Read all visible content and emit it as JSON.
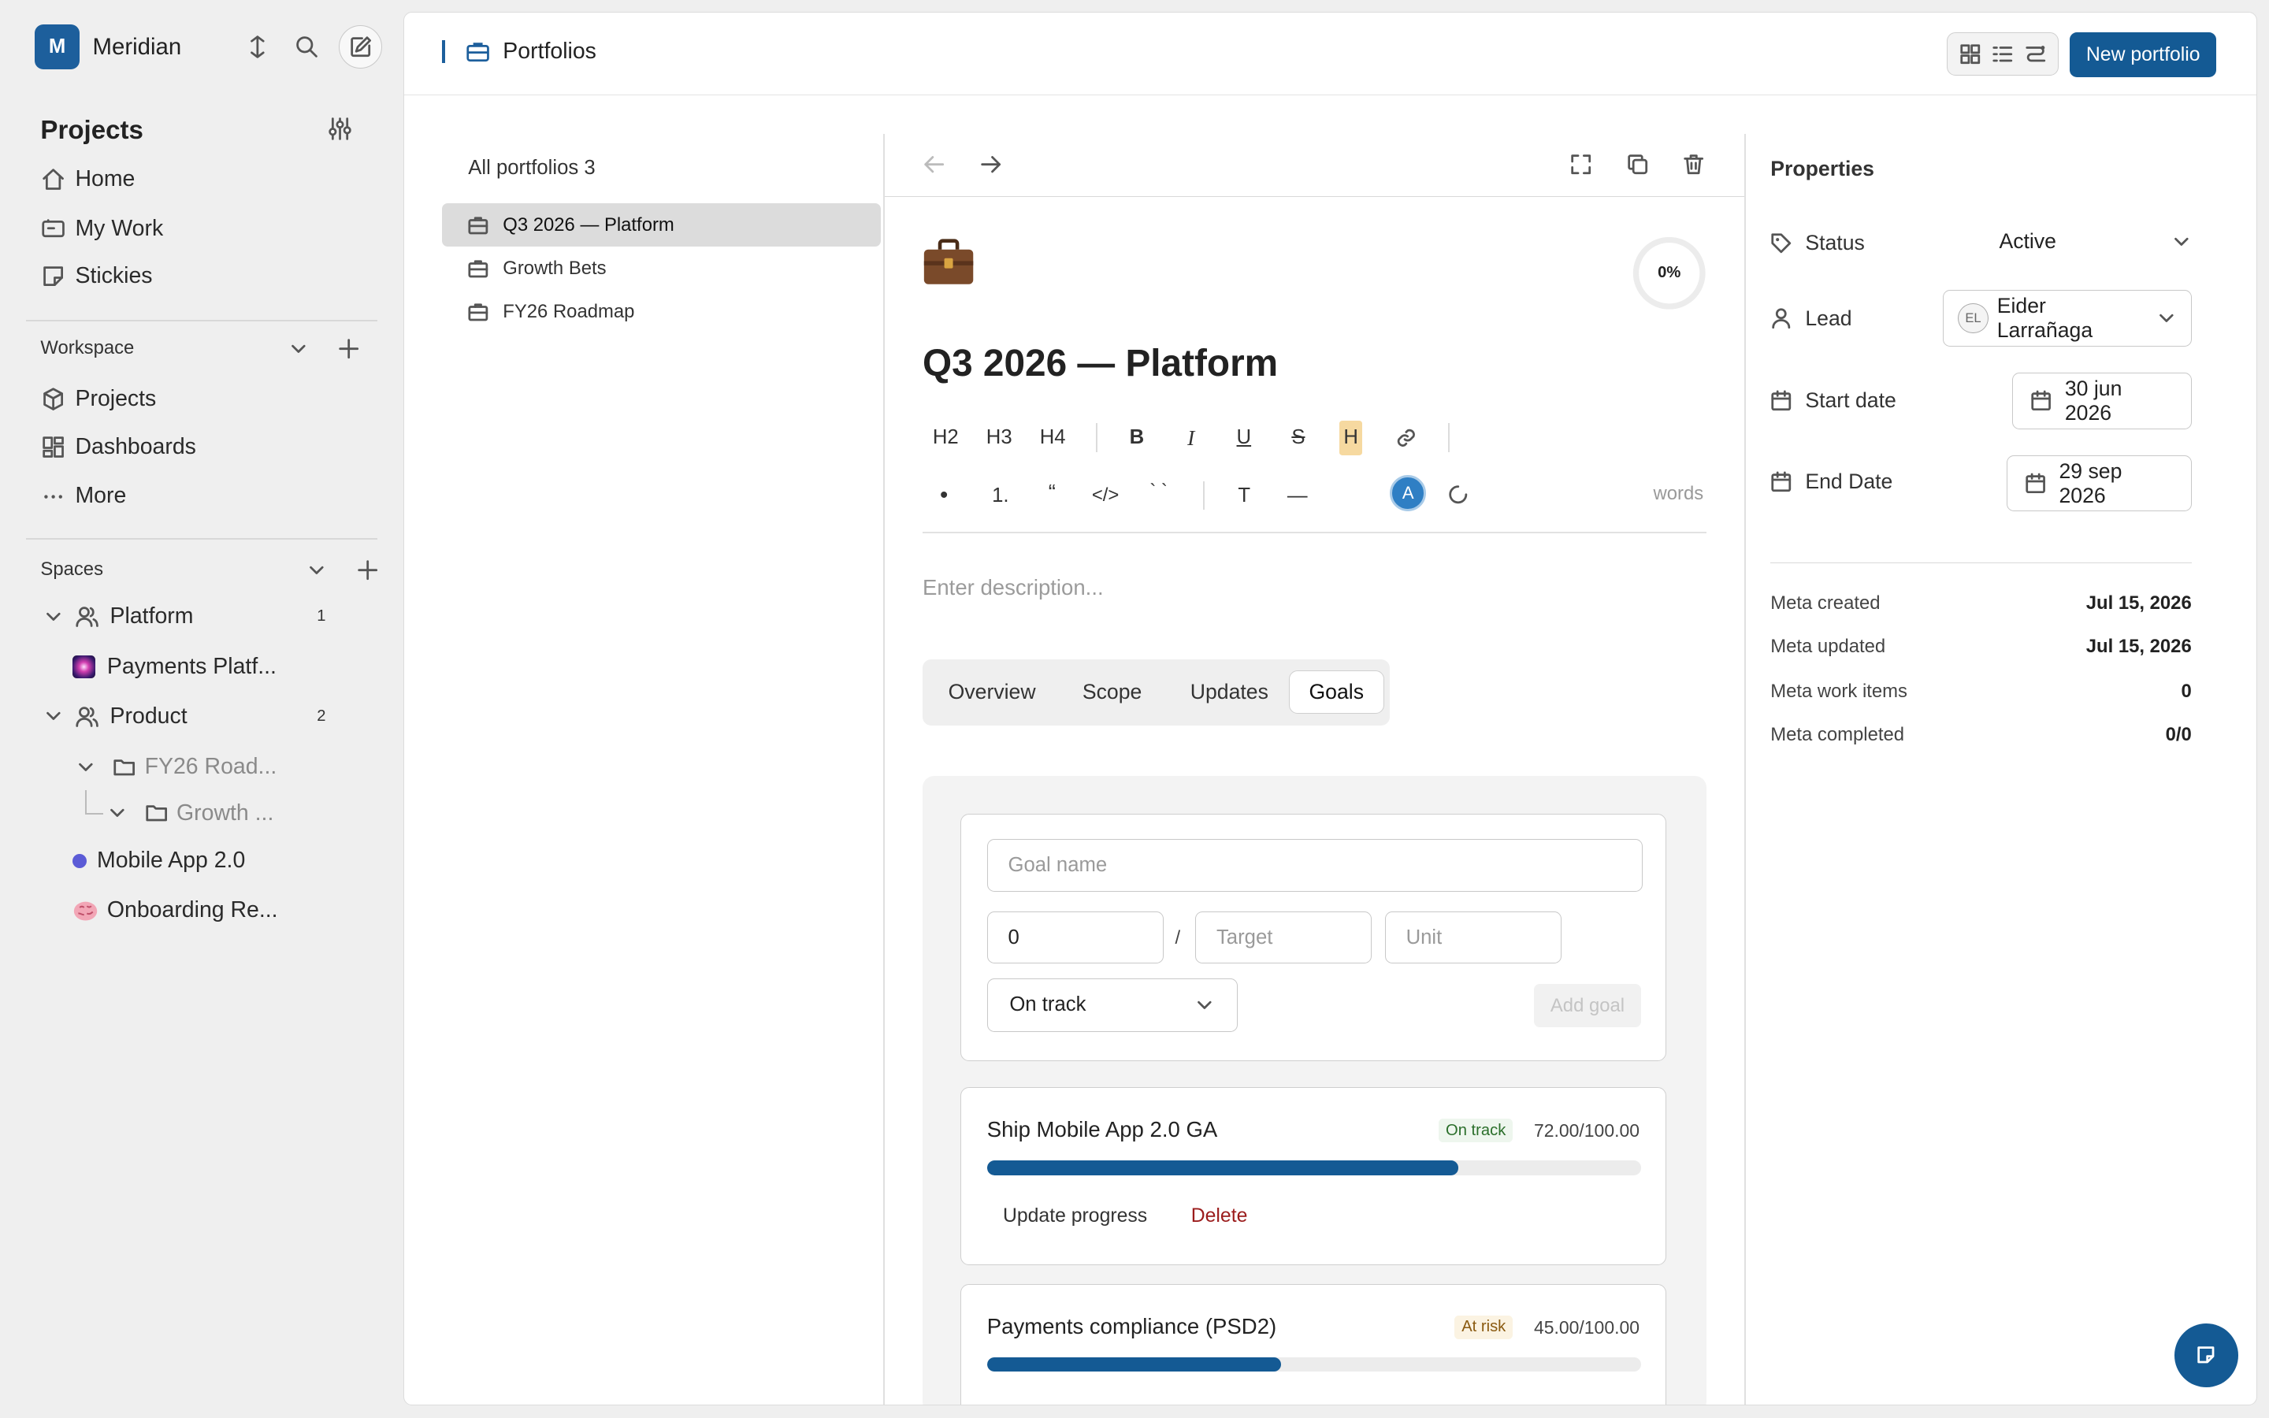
{
  "workspace": {
    "initial": "M",
    "name": "Meridian"
  },
  "sidebar": {
    "projects_heading": "Projects",
    "nav": [
      {
        "label": "Home",
        "icon": "home-icon"
      },
      {
        "label": "My Work",
        "icon": "briefcase-outline-icon"
      },
      {
        "label": "Stickies",
        "icon": "sticky-note-icon"
      }
    ],
    "workspace_heading": "Workspace",
    "workspace_items": [
      {
        "label": "Projects",
        "icon": "cube-icon"
      },
      {
        "label": "Dashboards",
        "icon": "dashboard-icon"
      },
      {
        "label": "More",
        "icon": "ellipsis-icon"
      }
    ],
    "spaces_heading": "Spaces",
    "spaces": {
      "platform": {
        "label": "Platform",
        "count": "1",
        "child": "Payments Platf..."
      },
      "product": {
        "label": "Product",
        "count": "2",
        "child1": "FY26 Road...",
        "child2": "Growth ..."
      },
      "mobile": {
        "label": "Mobile App 2.0",
        "dot_color": "#5b5bd6"
      },
      "onboarding": {
        "label": "Onboarding Re..."
      }
    }
  },
  "header": {
    "breadcrumb": "Portfolios",
    "new_button": "New portfolio"
  },
  "portfolio_list": {
    "title": "All portfolios 3",
    "items": [
      "Q3 2026 — Platform",
      "Growth Bets",
      "FY26 Roadmap"
    ],
    "selected_index": 0
  },
  "editor": {
    "emoji": "💼",
    "progress_label": "0%",
    "progress_value": 0,
    "title": "Q3 2026 — Platform",
    "format_row1": [
      "H2",
      "H3",
      "H4",
      "B",
      "I",
      "U",
      "S",
      "H"
    ],
    "format_row2": [
      "•",
      "1.",
      "“",
      "</>",
      "` `",
      "T",
      "—"
    ],
    "avatar_initial": "A",
    "words_label": "words",
    "description_placeholder": "Enter description...",
    "tabs": [
      "Overview",
      "Scope",
      "Updates",
      "Goals"
    ],
    "active_tab": "Goals",
    "goal_form": {
      "name_placeholder": "Goal name",
      "current_value": "0",
      "slash": "/",
      "target_placeholder": "Target",
      "unit_placeholder": "Unit",
      "status_selected": "On track",
      "add_button": "Add goal"
    },
    "goals": [
      {
        "name": "Ship Mobile App 2.0 GA",
        "status": "On track",
        "value": "72.00/100.00",
        "progress": 0.72,
        "update": "Update progress",
        "delete": "Delete"
      },
      {
        "name": "Payments compliance (PSD2)",
        "status": "At risk",
        "value": "45.00/100.00",
        "progress": 0.45
      }
    ]
  },
  "properties": {
    "title": "Properties",
    "status_label": "Status",
    "status_value": "Active",
    "lead_label": "Lead",
    "lead_initials": "EL",
    "lead_name": "Eider Larrañaga",
    "start_label": "Start date",
    "start_value": "30 jun 2026",
    "end_label": "End Date",
    "end_value": "29 sep 2026",
    "meta": [
      {
        "label": "Meta created",
        "value": "Jul 15, 2026"
      },
      {
        "label": "Meta updated",
        "value": "Jul 15, 2026"
      },
      {
        "label": "Meta work items",
        "value": "0"
      },
      {
        "label": "Meta completed",
        "value": "0/0"
      }
    ]
  },
  "colors": {
    "accent": "#145a94",
    "danger": "#9b1c1c",
    "selected_row": "#dcdcdc"
  }
}
